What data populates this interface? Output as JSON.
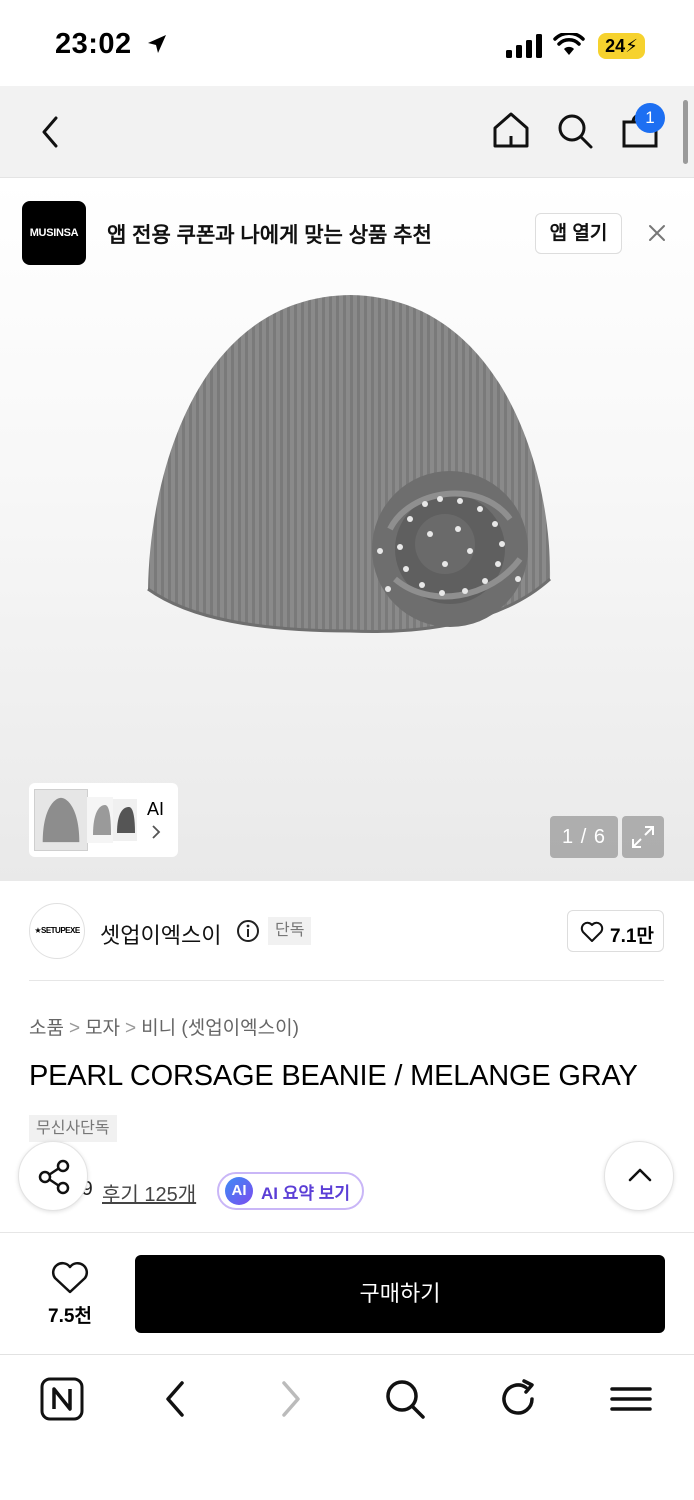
{
  "status_bar": {
    "time": "23:02",
    "battery": "24"
  },
  "navbar": {
    "cart_count": "1"
  },
  "app_banner": {
    "logo_text": "MUSINSA",
    "text": "앱 전용 쿠폰과 나에게 맞는 상품 추천",
    "open_button": "앱 열기"
  },
  "gallery": {
    "ai_label": "AI",
    "page_indicator": "1 / 6"
  },
  "brand": {
    "logo_text": "SETUPEXE",
    "name": "셋업이엑스이",
    "badge": "단독",
    "likes": "7.1만"
  },
  "product": {
    "breadcrumb": [
      "소품",
      "모자",
      "비니 (셋업이엑스이)"
    ],
    "title": "PEARL CORSAGE BEANIE / MELANGE GRAY",
    "tag": "무신사단독",
    "rating": "4.9",
    "reviews": "후기 125개",
    "ai_badge": "AI",
    "ai_summary": "AI 요약 보기"
  },
  "purchase": {
    "wish_count": "7.5천",
    "buy_label": "구매하기"
  },
  "colors": {
    "accent_blue": "#1d6ff2",
    "battery_yellow": "#f6d22e",
    "ai_purple": "#5b3ed6",
    "buy_button": "#000000"
  }
}
